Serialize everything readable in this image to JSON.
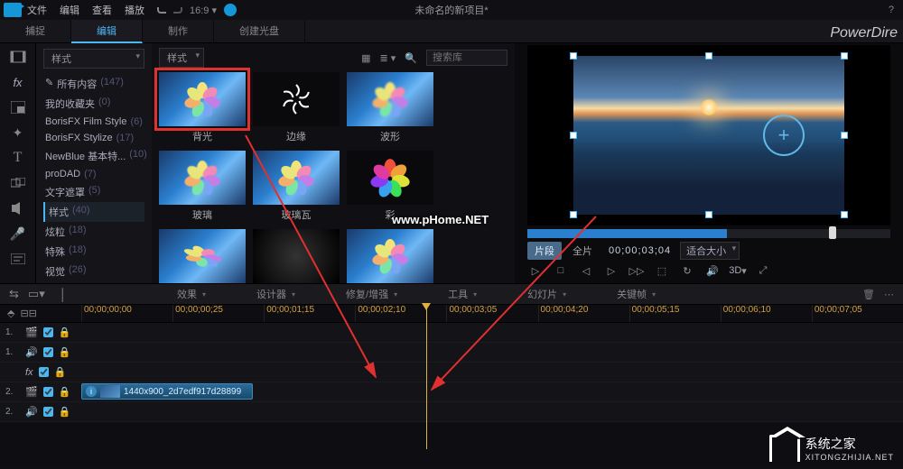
{
  "title": "未命名的新项目*",
  "brand": "PowerDire",
  "help": "?",
  "menu": [
    "文件",
    "编辑",
    "查看",
    "播放",
    "　",
    "　"
  ],
  "rooms": {
    "capture": "捕捉",
    "edit": "编辑",
    "produce": "制作",
    "disc": "创建光盘"
  },
  "leftIcons": [
    "film",
    "fx",
    "mask",
    "sparkle",
    "T",
    "pip",
    "grid",
    "mic",
    "sub"
  ],
  "sidebar": {
    "header": "样式",
    "items": [
      {
        "label": "所有内容",
        "count": "(147)",
        "sel": false
      },
      {
        "label": "我的收藏夹",
        "count": "(0)",
        "sel": false
      },
      {
        "label": "BorisFX Film Style",
        "count": "(6)",
        "sel": false
      },
      {
        "label": "BorisFX Stylize",
        "count": "(17)",
        "sel": false
      },
      {
        "label": "NewBlue 基本特...",
        "count": "(10)",
        "sel": false
      },
      {
        "label": "proDAD",
        "count": "(7)",
        "sel": false
      },
      {
        "label": "文字遮罩",
        "count": "(5)",
        "sel": false
      },
      {
        "label": "样式",
        "count": "(40)",
        "sel": true
      },
      {
        "label": "炫粒",
        "count": "(18)",
        "sel": false
      },
      {
        "label": "特殊",
        "count": "(18)",
        "sel": false
      },
      {
        "label": "视觉",
        "count": "(26)",
        "sel": false
      }
    ]
  },
  "search": {
    "placeholder": "搜索库"
  },
  "combo": "样式",
  "cards": [
    {
      "label": "背光",
      "sel": true,
      "kind": "flower"
    },
    {
      "label": "边缘",
      "sel": false,
      "kind": "spiral"
    },
    {
      "label": "波形",
      "sel": false,
      "kind": "flower"
    },
    {
      "label": "玻璃",
      "sel": false,
      "kind": "flower"
    },
    {
      "label": "玻璃瓦",
      "sel": false,
      "kind": "flower"
    },
    {
      "label": "彩",
      "sel": false,
      "kind": "flower2"
    }
  ],
  "preview": {
    "modeClip": "片段",
    "modeMovie": "全片",
    "timecode": "00;00;03;04",
    "fit": "适合大小",
    "three": "3D"
  },
  "toolbar": {
    "effect": "效果",
    "designer": "设计器",
    "fix": "修复/增强",
    "tools": "工具",
    "slide": "幻灯片",
    "keyframe": "关键帧"
  },
  "ruler": [
    "00;00;00;00",
    "00;00;00;25",
    "00;00;01;15",
    "00;00;02;10",
    "00;00;03;05",
    "00;00;04;20",
    "00;00;05;15",
    "00;00;06;10",
    "00;00;07;05"
  ],
  "tracks": [
    {
      "n": "1.",
      "t": "v"
    },
    {
      "n": "1.",
      "t": "a"
    },
    {
      "n": "",
      "t": "fx"
    },
    {
      "n": "2.",
      "t": "v",
      "clip": true
    },
    {
      "n": "2.",
      "t": "a"
    }
  ],
  "clip": {
    "label": "1440x900_2d7edf917d28899",
    "width": 190
  },
  "playhead": 472,
  "scrub": {
    "fill": 55,
    "knob": 83
  },
  "watermarks": {
    "phome": "www.pHome.NET",
    "xtzj": "系统之家",
    "xturl": "XITONGZHIJIA.NET"
  }
}
